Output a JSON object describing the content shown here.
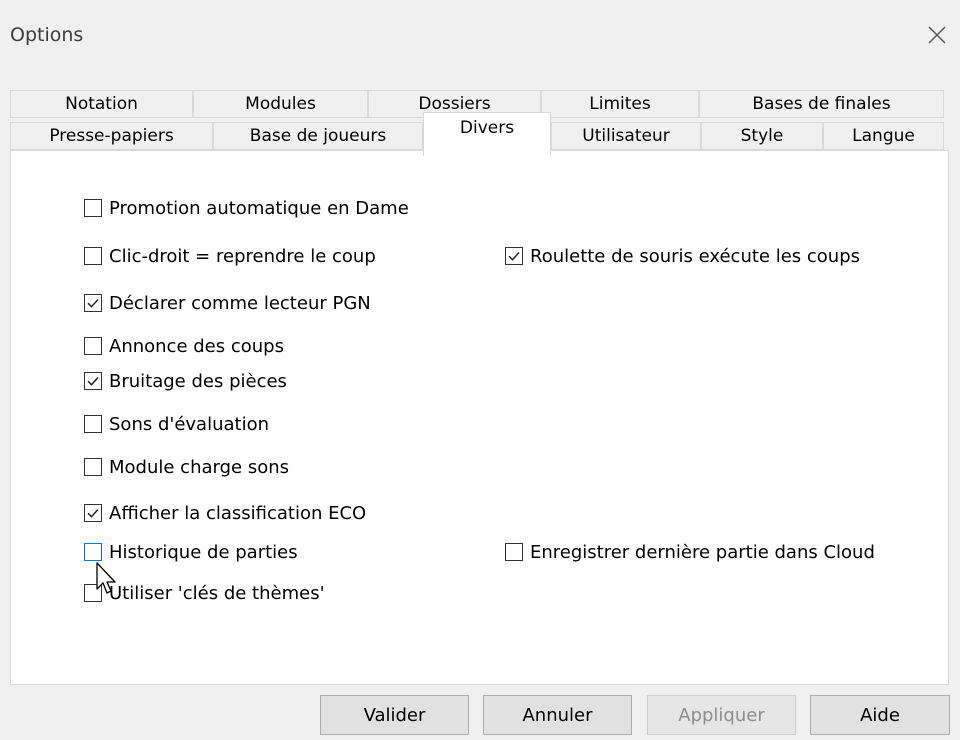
{
  "dialog": {
    "title": "Options"
  },
  "tabs": {
    "row1": [
      "Notation",
      "Modules",
      "Dossiers",
      "Limites",
      "Bases de finales"
    ],
    "row2": [
      "Presse-papiers",
      "Base de joueurs",
      "Divers",
      "Utilisateur",
      "Style",
      "Langue"
    ],
    "active": "Divers"
  },
  "options": [
    {
      "label": "Promotion automatique en Dame",
      "checked": false
    },
    {
      "label": "Clic-droit = reprendre le coup",
      "checked": false
    },
    {
      "label": "Roulette de souris exécute les coups",
      "checked": true
    },
    {
      "label": "Déclarer comme lecteur PGN",
      "checked": true
    },
    {
      "label": "Annonce des coups",
      "checked": false
    },
    {
      "label": "Bruitage des pièces",
      "checked": true
    },
    {
      "label": "Sons d'évaluation",
      "checked": false
    },
    {
      "label": "Module charge sons",
      "checked": false
    },
    {
      "label": "Afficher la classification ECO",
      "checked": true
    },
    {
      "label": "Historique de parties",
      "checked": false
    },
    {
      "label": "Enregistrer dernière partie dans Cloud",
      "checked": false
    },
    {
      "label": "Utiliser 'clés de thèmes'",
      "checked": false
    }
  ],
  "buttons": {
    "ok": "Valider",
    "cancel": "Annuler",
    "apply": "Appliquer",
    "help": "Aide"
  },
  "icons": {
    "close": "close-icon",
    "checkmark": "checkmark-icon",
    "cursor": "mouse-pointer-icon"
  },
  "colors": {
    "window": "#f0f0f0",
    "panel": "#ffffff",
    "focus": "#0078d7",
    "disabled_text": "#8d8d8d"
  }
}
